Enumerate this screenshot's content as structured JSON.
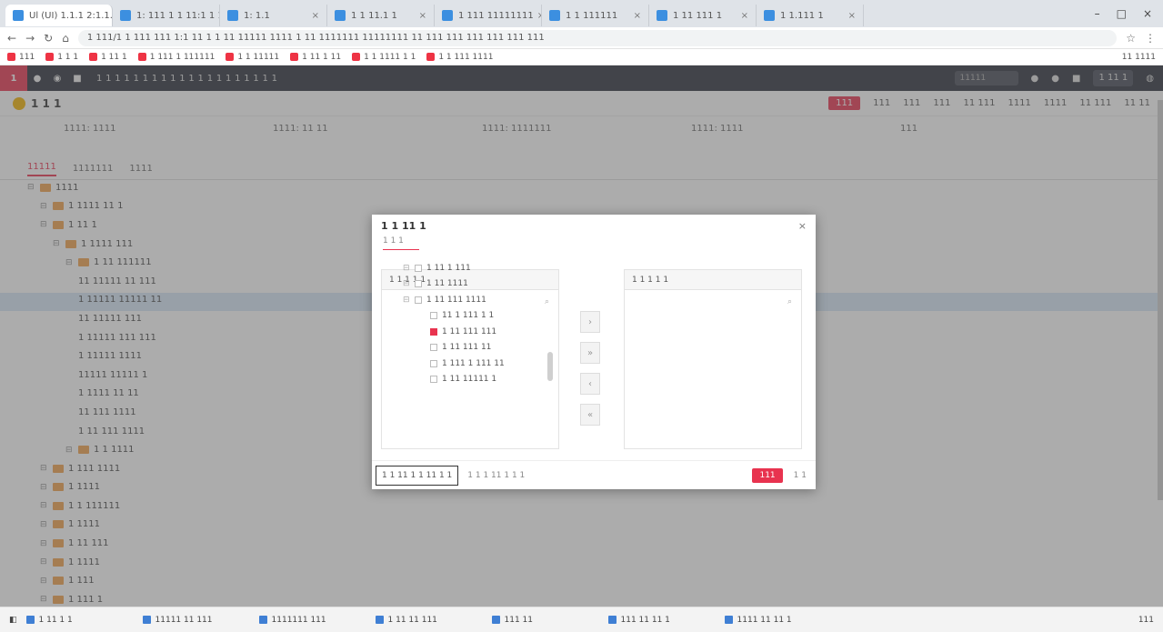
{
  "browser": {
    "tabs": [
      {
        "label": "Ul (UI) 1.1.1 2:1.1.1"
      },
      {
        "label": "1: 111 1 1 11:1 1 1"
      },
      {
        "label": "1: 1.1"
      },
      {
        "label": "1 1 11.1 1"
      },
      {
        "label": "1 111 11111111"
      },
      {
        "label": "1 1 111111"
      },
      {
        "label": "1 11 111 1"
      },
      {
        "label": "1 1.111 1"
      }
    ],
    "url": "1 111/1 1 111 111 1:1 11 1 1 11 11111 1111 1 11 1111111 11111111 11 111 111 111 111 111 111",
    "bookmarks": [
      "111",
      "1 1 1",
      "1 11 1",
      "1 111 1 111111",
      "1 1 11111",
      "1 11 1 11",
      "1 1 1111 1 1",
      "1 1 111 1111"
    ],
    "bookmarks_right": "11 1111"
  },
  "app": {
    "logo": "1",
    "breadcrumb": "1 1 1 1 1 1 1 1 1 1 1 1 1 1 1 1 1 1 1 1",
    "search_placeholder": "11111",
    "user": "1 11 1"
  },
  "page": {
    "title": "1 1 1",
    "toolbar_buttons": [
      "111",
      "111",
      "111",
      "11 111",
      "1111",
      "1111",
      "11 111",
      "11 11"
    ],
    "primary_button": "111",
    "form": [
      "1111: 1111",
      "1111: 11 11",
      "1111: 1111111",
      "1111: 1111"
    ],
    "form_extra": "111",
    "subtabs": [
      "11111",
      "1111111",
      "1111"
    ],
    "tree": [
      {
        "label": "1111",
        "level": 0
      },
      {
        "label": "1 1111 11 1",
        "level": 1
      },
      {
        "label": "1 11 1",
        "level": 1
      },
      {
        "label": "1 1111 111",
        "level": 2
      },
      {
        "label": "1 11 111111",
        "level": 3
      },
      {
        "label": "11 11111 11 111",
        "level": 4
      },
      {
        "label": "1 11111 11111 11",
        "level": 4
      },
      {
        "label": "11 11111 111",
        "level": 4
      },
      {
        "label": "1 11111 111 111",
        "level": 4
      },
      {
        "label": "1 11111 1111",
        "level": 4
      },
      {
        "label": "11111 11111 1",
        "level": 4
      },
      {
        "label": "1 1111 11 11",
        "level": 4
      },
      {
        "label": "11 111 1111",
        "level": 4
      },
      {
        "label": "1 11 111 1111",
        "level": 4
      },
      {
        "label": "1 1 1111",
        "level": 3
      },
      {
        "label": "1 111 1111",
        "level": 1
      },
      {
        "label": "1 1111",
        "level": 1
      },
      {
        "label": "1 1 111111",
        "level": 1
      },
      {
        "label": "1 1111",
        "level": 1
      },
      {
        "label": "1 11 111",
        "level": 1
      },
      {
        "label": "1 1111",
        "level": 1
      },
      {
        "label": "1 111",
        "level": 1
      },
      {
        "label": "1 111 1",
        "level": 1
      }
    ]
  },
  "dialog": {
    "title": "1 1 11 1",
    "tab": "1 1 1",
    "left_panel_header": "1 1 1 1 1",
    "right_panel_header": "1 1 1 1 1",
    "tree": [
      {
        "label": "1 11 1 111",
        "checked": false,
        "child": false
      },
      {
        "label": "1 11 1111",
        "checked": false,
        "child": false
      },
      {
        "label": "1 11 111 1111",
        "checked": false,
        "child": false
      },
      {
        "label": "11 1 111 1 1",
        "checked": false,
        "child": true
      },
      {
        "label": "1 11 111 111",
        "checked": true,
        "child": true
      },
      {
        "label": "1 11 111 11",
        "checked": false,
        "child": true
      },
      {
        "label": "1 111 1 111 11",
        "checked": false,
        "child": true
      },
      {
        "label": "1 11 11111 1",
        "checked": false,
        "child": true
      }
    ],
    "footer_option_1": "1 1 11 1 1 11 1 1",
    "footer_option_2": "1 1 1 11 1 1 1",
    "ok_label": "111",
    "cancel_label": "1 1"
  },
  "taskbar": {
    "items": [
      "1 11 1 1",
      "11111 11 111",
      "1111111 111",
      "1 11 11 111",
      "111 11",
      "111 11 11 1",
      "1111 11 11 1"
    ],
    "clock": "111"
  },
  "colors": {
    "accent": "#e8334f",
    "header_bg": "#2b2f3a"
  }
}
